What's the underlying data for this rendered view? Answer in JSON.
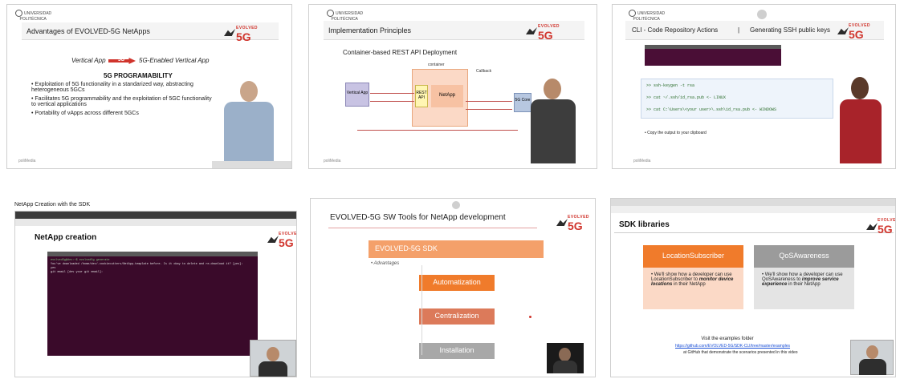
{
  "tiles": {
    "t1": {
      "title": "Advantages of EVOLVED-5G NetApps",
      "flow_left": "Vertical App",
      "flow_right": "5G-Enabled Vertical App",
      "flow_badge": "5G",
      "section_title": "5G PROGRAMABILITY",
      "bullets": [
        "Exploitation of 5G functionality in a standarized way, abstracting heterogeneous 5GCs",
        "Facilitates 5G programmability and the exploitation of 5GC functionality to vertical applications",
        "Portability of vApps across different 5GCs"
      ],
      "footer": "poliMedia"
    },
    "t2": {
      "title": "Implementation Principles",
      "subtitle": "Container-based REST API Deployment",
      "container_label": "container",
      "vertical_app": "Vertical App",
      "rest_api": "REST API",
      "netapp": "NetApp",
      "core": "5G Core",
      "callback": "Callback",
      "footer": "poliMedia"
    },
    "t3": {
      "title": "CLI - Code Repository Actions",
      "separator": "|",
      "title2": "Generating SSH public keys",
      "cmd1": ">> ssh-keygen -t rsa",
      "cmd2": ">> cat ~/.ssh/id_rsa.pub   <- LINUX",
      "cmd3": ">> cat C:\\Users\\<your user>\\.ssh\\id_rsa.pub   <- WINDOWS",
      "bullet": "Copy the output to your clipboard",
      "footer": "poliMedia"
    },
    "t4": {
      "caption": "NetApp Creation with the SDK",
      "heading": "NetApp creation",
      "terminal_lines": [
        "evolved5g@dev:~$ evolved5g generate",
        "You've downloaded /home/dev/.cookiecutters/NetApp-template before. Is it okay to delete and re-download it? [yes]:",
        "yes",
        "git email [dev your git email]: "
      ]
    },
    "t5": {
      "title": "EVOLVED-5G SW Tools for NetApp development",
      "sdk_label": "EVOLVED-5G SDK",
      "advantages": "Advantages",
      "items": [
        "Automatization",
        "Centralization",
        "Installation"
      ]
    },
    "t6": {
      "heading": "SDK libraries",
      "box1_title": "LocationSubscriber",
      "box1_text_a": "We'll show how a developer can use LocationSubscriber to ",
      "box1_text_em": "monitor device locations",
      "box1_text_b": " in their NetApp",
      "box2_title": "QoSAwareness",
      "box2_text_a": "We'll show how a developer can use QoSAwareness to ",
      "box2_text_em": "improve service experience",
      "box2_text_b": " in their NetApp",
      "visit": "Visit the examples folder",
      "link": "https://github.com/EVOLVED-5G/SDK-CLI/tree/master/examples",
      "after_link": "at GitHub that demonstrate the scenarios presented in this video"
    }
  },
  "colors": {
    "brand_red": "#d0342c",
    "orange": "#f07b2b",
    "gray_box": "#9b9b9b",
    "terminal": "#3a0a2a"
  }
}
